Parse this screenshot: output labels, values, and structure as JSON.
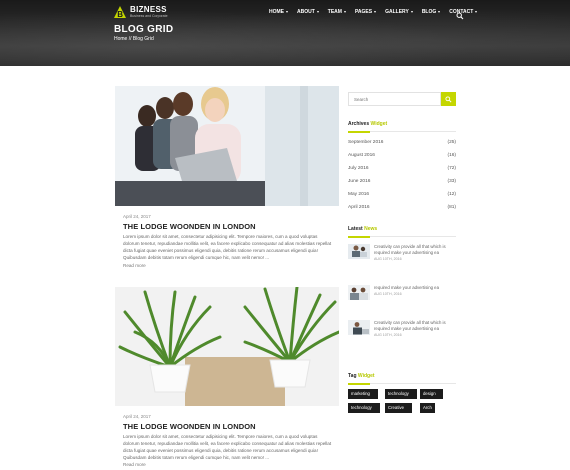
{
  "header": {
    "logo_title": "BIZNESS",
    "logo_tagline": "Business and Corporate",
    "nav": [
      {
        "label": "HOME"
      },
      {
        "label": "ABOUT"
      },
      {
        "label": "TEAM"
      },
      {
        "label": "PAGES"
      },
      {
        "label": "GALLERY"
      },
      {
        "label": "BLOG"
      },
      {
        "label": "CONTACT"
      }
    ],
    "search_icon": "search-icon",
    "page_title": "BLOG GRID",
    "breadcrumb": "Home // Blog Grid"
  },
  "posts": [
    {
      "date": "April 24, 2017",
      "title": "THE LODGE WOONDEN IN LONDON",
      "text": "Lorem ipsum dolor sit amet, consectetur adipisicing elit. Tempore maiores, cum a quod voluptas dolorum tenetur, repudiandae mollitia velit, ea facere explicabo consequatur ad alias molestias repellat dicta fugiat quae eveniet possimus eligendi quia, debitis ratione rerum accusamus eligendi quia! Quibusdam debitis totam rerum eligendi cumque hic, nam velit nemo! ...",
      "read_more": "Read more"
    },
    {
      "date": "April 24, 2017",
      "title": "THE LODGE WOONDEN IN LONDON",
      "text": "Lorem ipsum dolor sit amet, consectetur adipisicing elit. Tempore maiores, cum a quod voluptas dolorum tenetur, repudiandae mollitia velit, ea facere explicabo consequatur ad alias molestias repellat dicta fugiat quae eveniet possimus eligendi quia, debitis ratione rerum accusamus eligendi quia! Quibusdam debitis totam rerum eligendi cumque hic, nam velit nemo! ...",
      "read_more": "Read more"
    }
  ],
  "sidebar": {
    "search_placeholder": "Search",
    "archives": {
      "title_main": "Archives",
      "title_accent": "Widget",
      "items": [
        {
          "label": "September 2016",
          "count": "(25)"
        },
        {
          "label": "August 2016",
          "count": "(16)"
        },
        {
          "label": "July 2016",
          "count": "(72)"
        },
        {
          "label": "June 2016",
          "count": "(33)"
        },
        {
          "label": "May 2016",
          "count": "(12)"
        },
        {
          "label": "April 2016",
          "count": "(81)"
        }
      ]
    },
    "news": {
      "title_main": "Latest",
      "title_accent": "News",
      "items": [
        {
          "text": "Creativity can provide all that which is required make your advertising ea",
          "date": "AUG 10TH, 2016"
        },
        {
          "text": "required make your advertising ea",
          "date": "AUG 10TH, 2016"
        },
        {
          "text": "Creativity can provide all that which is required make your advertising ea",
          "date": "AUG 10TH, 2016"
        }
      ]
    },
    "tags": {
      "title_main": "Tag",
      "title_accent": "Widget",
      "items": [
        "marketing",
        "technology",
        "design",
        "technology",
        "Creative",
        "Arch"
      ]
    }
  },
  "colors": {
    "accent": "#c4d600",
    "tag_bg": "#1c1c1c"
  }
}
